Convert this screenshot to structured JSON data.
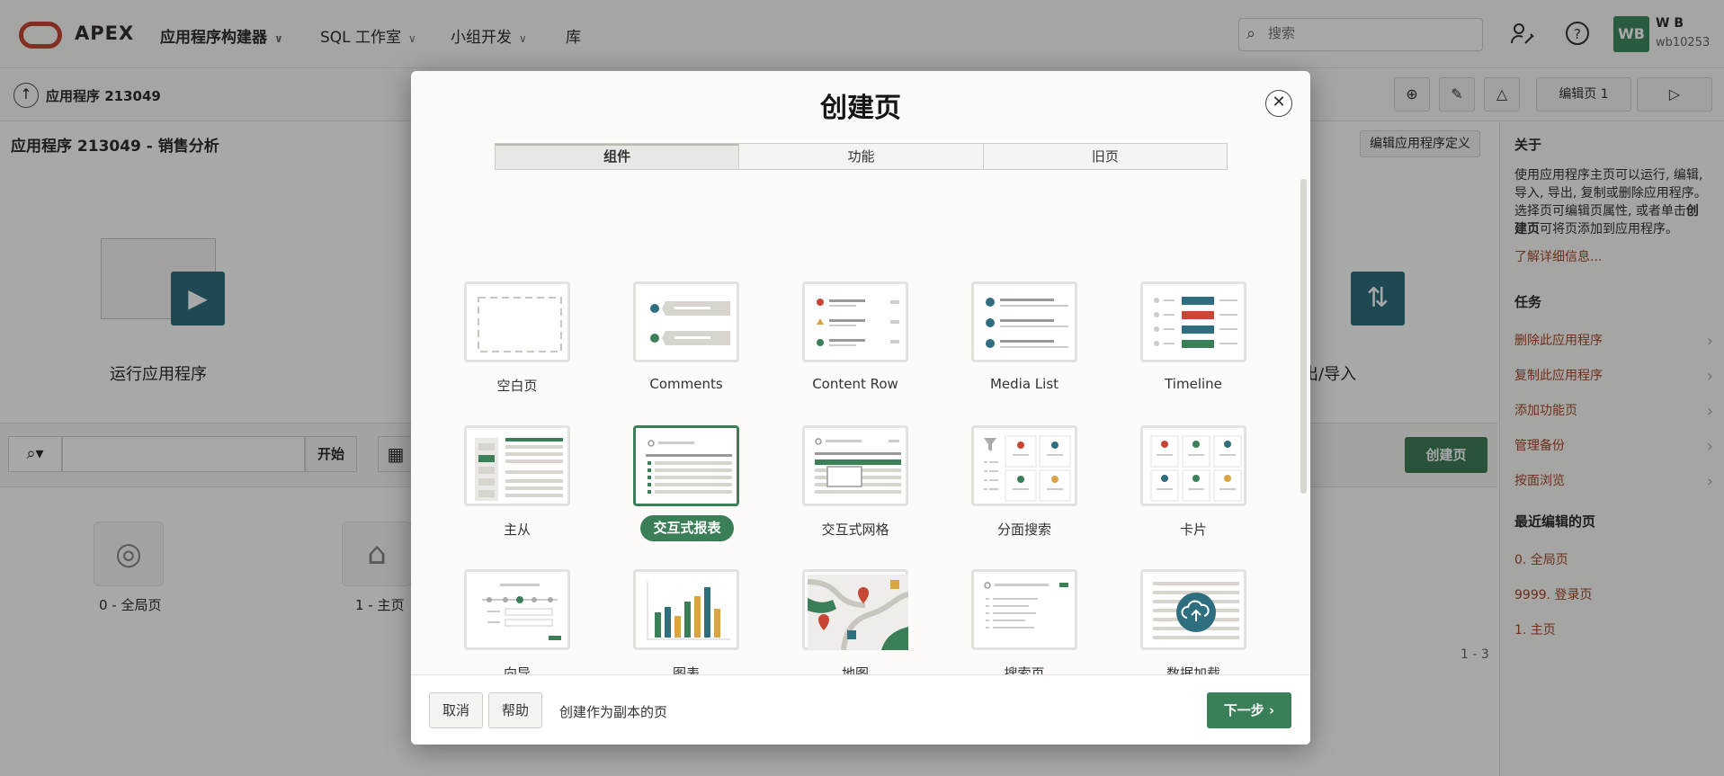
{
  "header": {
    "logo_text": "APEX",
    "nav": [
      {
        "label": "应用程序构建器",
        "bold": true
      },
      {
        "label": "SQL 工作室",
        "bold": false
      },
      {
        "label": "小组开发",
        "bold": false
      },
      {
        "label": "库",
        "bold": false
      }
    ],
    "search_placeholder": "搜索",
    "user": {
      "initials": "WB",
      "name": "W B",
      "id": "wb10253"
    },
    "icons": [
      "admin-wrench-icon",
      "help-icon"
    ]
  },
  "toolbar": {
    "app_title": "应用程序 213049",
    "edit_page_label": "编辑页 1"
  },
  "page": {
    "heading": "应用程序 213049 - 销售分析",
    "edit_app_def": "编辑应用程序定义",
    "run_label": "运行应用程序",
    "export_label": "导出/导入",
    "search_go": "开始",
    "create_page": "创建页",
    "pages": [
      {
        "label": "0 - 全局页"
      },
      {
        "label": "1 - 主页"
      }
    ],
    "pager": "1 - 3"
  },
  "right_panel": {
    "about_title": "关于",
    "about_text_1": "使用应用程序主页可以运行, 编辑, 导入, 导出, 复制或删除应用程序。选择页可编辑页属性, 或者单击",
    "about_text_bold": "创建页",
    "about_text_2": "可将页添加到应用程序。",
    "learn_more": "了解详细信息...",
    "tasks_title": "任务",
    "tasks": [
      "删除此应用程序",
      "复制此应用程序",
      "添加功能页",
      "管理备份",
      "按面浏览"
    ],
    "recent_title": "最近编辑的页",
    "recent": [
      "0. 全局页",
      "9999. 登录页",
      "1. 主页"
    ]
  },
  "dialog": {
    "title": "创建页",
    "tabs": [
      {
        "label": "组件",
        "active": true
      },
      {
        "label": "功能",
        "active": false
      },
      {
        "label": "旧页",
        "active": false
      }
    ],
    "cards": [
      {
        "label": "空白页",
        "icon": "blank-page-icon",
        "selected": false
      },
      {
        "label": "Comments",
        "icon": "comments-icon",
        "selected": false
      },
      {
        "label": "Content Row",
        "icon": "content-row-icon",
        "selected": false
      },
      {
        "label": "Media List",
        "icon": "media-list-icon",
        "selected": false
      },
      {
        "label": "Timeline",
        "icon": "timeline-icon",
        "selected": false
      },
      {
        "label": "主从",
        "icon": "master-detail-icon",
        "selected": false
      },
      {
        "label": "交互式报表",
        "icon": "interactive-report-icon",
        "selected": true
      },
      {
        "label": "交互式网格",
        "icon": "interactive-grid-icon",
        "selected": false
      },
      {
        "label": "分面搜索",
        "icon": "faceted-search-icon",
        "selected": false
      },
      {
        "label": "卡片",
        "icon": "cards-icon",
        "selected": false
      },
      {
        "label": "向导",
        "icon": "wizard-icon",
        "selected": false
      },
      {
        "label": "图表",
        "icon": "chart-icon",
        "selected": false
      },
      {
        "label": "地图",
        "icon": "map-icon",
        "selected": false
      },
      {
        "label": "搜索页",
        "icon": "search-page-icon",
        "selected": false
      },
      {
        "label": "数据加载",
        "icon": "data-load-icon",
        "selected": false
      }
    ],
    "footer": {
      "cancel": "取消",
      "help": "帮助",
      "copy_text": "创建作为副本的页",
      "next": "下一步"
    }
  },
  "colors": {
    "accent_green": "#3a7f58",
    "brand_red": "#c74634",
    "teal": "#2e6e7e",
    "link": "#a54a2a"
  }
}
